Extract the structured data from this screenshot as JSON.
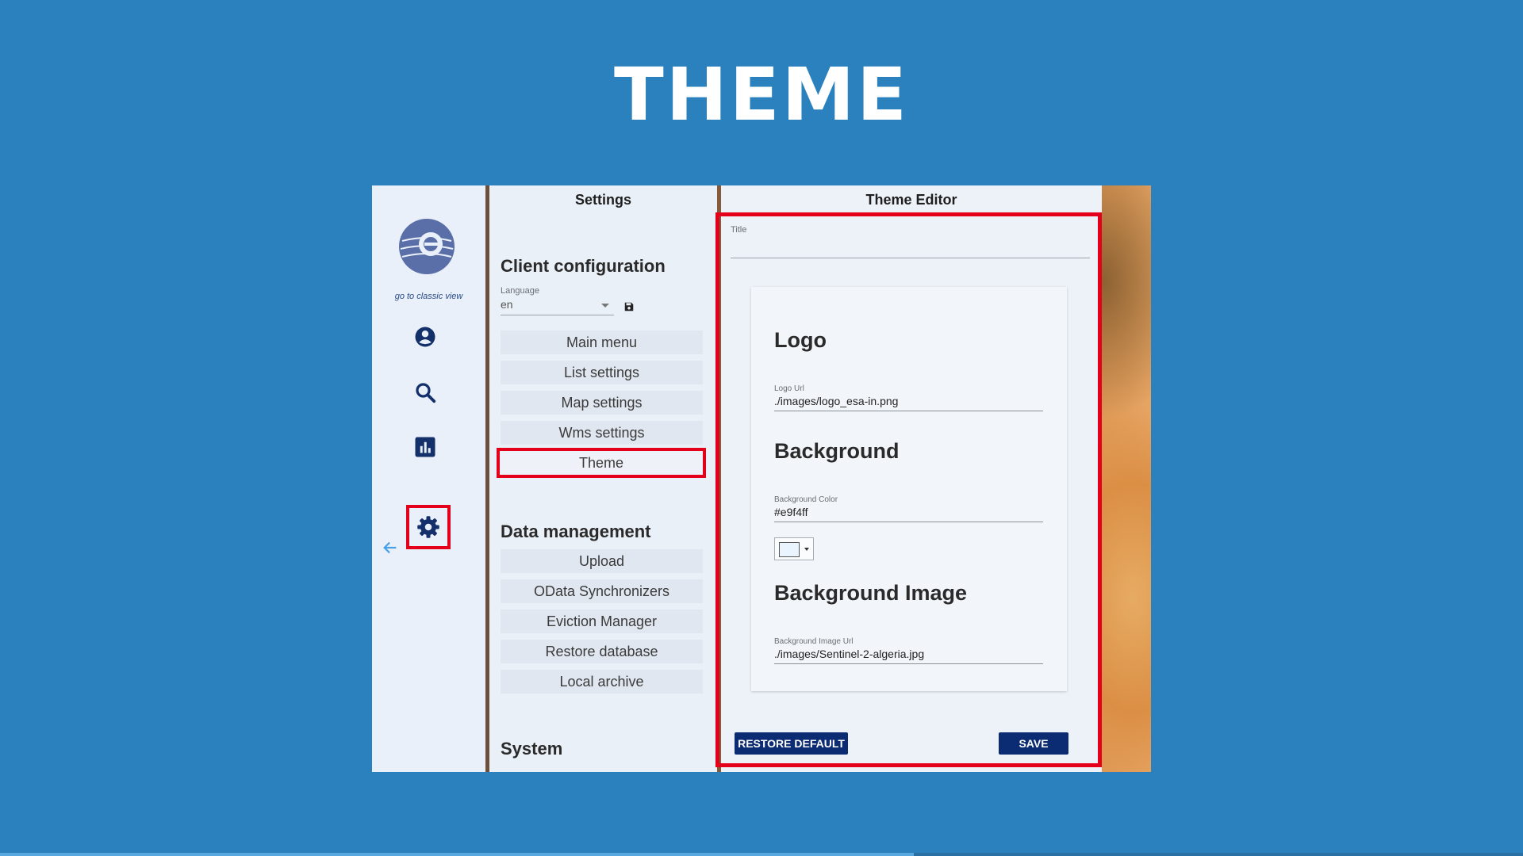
{
  "slide": {
    "title": "THEME",
    "progress_percent": 60
  },
  "rail": {
    "classic_link": "go to classic view",
    "icons": [
      "esa-logo",
      "account-icon",
      "search-icon",
      "bar-chart-icon",
      "settings-icon",
      "arrow-left-icon"
    ]
  },
  "settings": {
    "title": "Settings",
    "client_heading": "Client configuration",
    "language_label": "Language",
    "language_value": "en",
    "client_items": [
      "Main menu",
      "List settings",
      "Map settings",
      "Wms settings",
      "Theme"
    ],
    "data_heading": "Data management",
    "data_items": [
      "Upload",
      "OData Synchronizers",
      "Eviction Manager",
      "Restore database",
      "Local archive"
    ],
    "system_heading": "System"
  },
  "editor": {
    "title": "Theme Editor",
    "title_field_label": "Title",
    "logo_heading": "Logo",
    "logo_url_label": "Logo Url",
    "logo_url_value": "./images/logo_esa-in.png",
    "background_heading": "Background",
    "background_color_label": "Background Color",
    "background_color_value": "#e9f4ff",
    "background_image_heading": "Background Image",
    "background_image_label": "Background Image Url",
    "background_image_value": "./images/Sentinel-2-algeria.jpg",
    "restore_label": "RESTORE DEFAULT",
    "save_label": "SAVE"
  },
  "colors": {
    "slide_background": "#2b81bd",
    "highlight_red": "#e4001b",
    "button_navy": "#0b2b72",
    "icon_navy": "#13306b"
  }
}
